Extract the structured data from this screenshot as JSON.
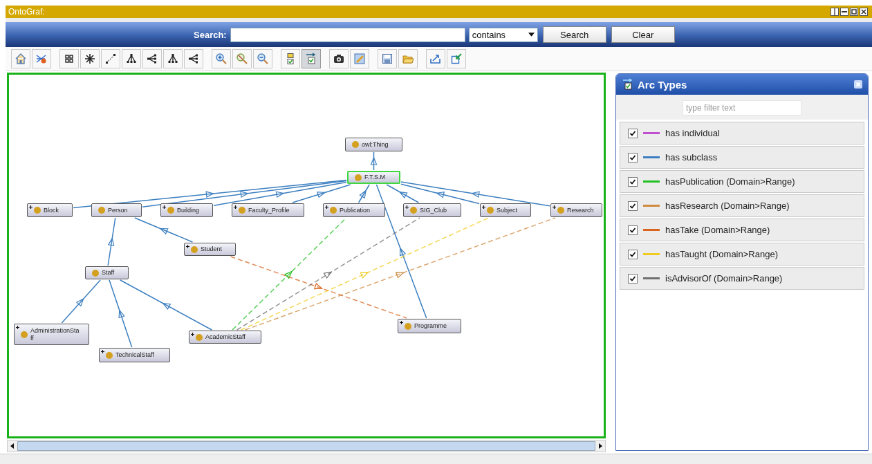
{
  "window": {
    "title": "OntoGraf:"
  },
  "search": {
    "label": "Search:",
    "mode": "contains",
    "buttons": [
      "Search",
      "Clear"
    ]
  },
  "toolbar": [
    {
      "selected": false
    },
    {
      "selected": false
    },
    {
      "selected": false
    },
    {
      "selected": false
    },
    {
      "selected": false
    },
    {
      "selected": false
    },
    {
      "selected": false
    },
    {
      "selected": false
    },
    {
      "selected": false
    },
    {
      "selected": false
    },
    {
      "selected": false
    },
    {
      "selected": false
    },
    {
      "selected": false
    },
    {
      "selected": true
    },
    {
      "selected": false
    },
    {
      "selected": false
    },
    {
      "selected": false
    },
    {
      "selected": false
    },
    {
      "selected": false
    },
    {
      "selected": false
    }
  ],
  "graph": {
    "nodes": [
      {
        "label": "owl:Thing",
        "selected": false,
        "expandable": false
      },
      {
        "label": "F.T.S.M",
        "selected": true,
        "expandable": false
      },
      {
        "label": "Block",
        "selected": false,
        "expandable": true
      },
      {
        "label": "Person",
        "selected": false,
        "expandable": false
      },
      {
        "label": "Building",
        "selected": false,
        "expandable": true
      },
      {
        "label": "Faculty_Profile",
        "selected": false,
        "expandable": true
      },
      {
        "label": "Publication",
        "selected": false,
        "expandable": true
      },
      {
        "label": "SIG_Club",
        "selected": false,
        "expandable": true
      },
      {
        "label": "Subject",
        "selected": false,
        "expandable": true
      },
      {
        "label": "Research",
        "selected": false,
        "expandable": true
      },
      {
        "label": "Student",
        "selected": false,
        "expandable": true
      },
      {
        "label": "Staff",
        "selected": false,
        "expandable": false
      },
      {
        "label": "AdministrationStaff",
        "selected": false,
        "expandable": true
      },
      {
        "label": "AcademicStaff",
        "selected": false,
        "expandable": true
      },
      {
        "label": "TechnicalStaff",
        "selected": false,
        "expandable": true
      },
      {
        "label": "Programme",
        "selected": false,
        "expandable": true
      }
    ]
  },
  "arc_types": {
    "title": "Arc Types",
    "filter_placeholder": "type filter text",
    "items": [
      {
        "label": "has individual",
        "checked": true,
        "color": "#c050d0"
      },
      {
        "label": "has subclass",
        "checked": true,
        "color": "#3c7fc0"
      },
      {
        "label": "hasPublication (Domain>Range)",
        "checked": true,
        "color": "#22c022"
      },
      {
        "label": "hasResearch (Domain>Range)",
        "checked": true,
        "color": "#d08a40"
      },
      {
        "label": "hasTake (Domain>Range)",
        "checked": true,
        "color": "#d8641e"
      },
      {
        "label": "hasTaught (Domain>Range)",
        "checked": true,
        "color": "#f0cc20"
      },
      {
        "label": "isAdvisorOf (Domain>Range)",
        "checked": true,
        "color": "#707070"
      }
    ]
  }
}
